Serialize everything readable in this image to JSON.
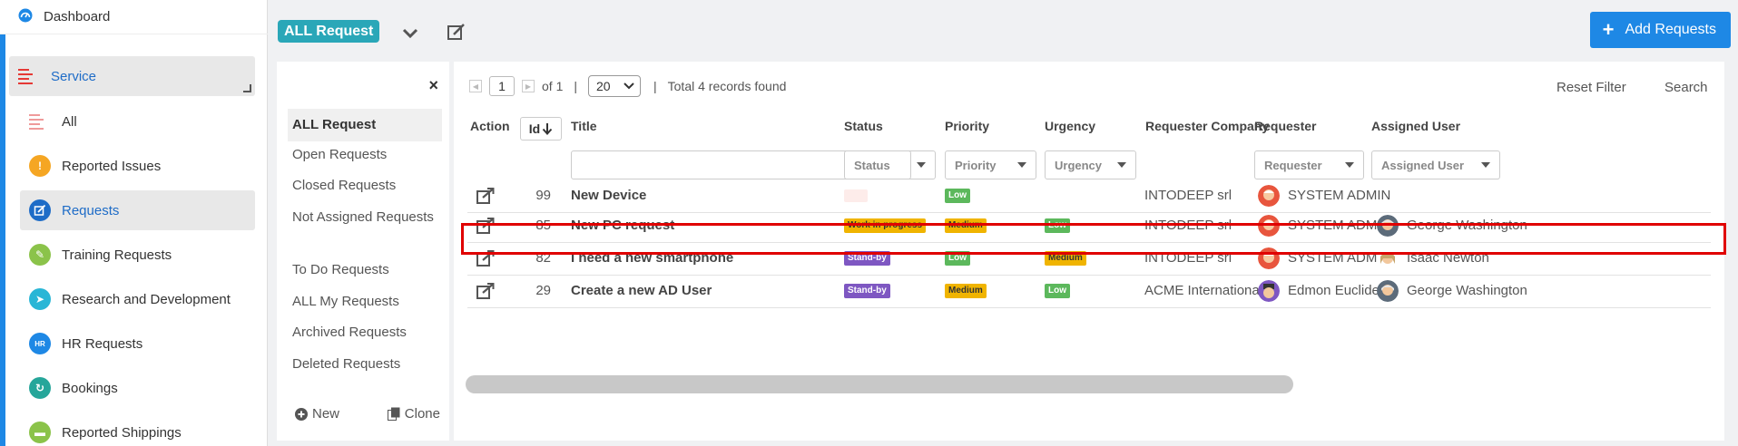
{
  "sidebar": {
    "dashboard_label": "Dashboard",
    "service_label": "Service",
    "items": [
      {
        "label": "All",
        "icon": "list-icon",
        "color": "#e53935"
      },
      {
        "label": "Reported Issues",
        "icon": "warning-icon",
        "color": "#f5a623"
      },
      {
        "label": "Requests",
        "icon": "edit-request-icon",
        "color": "#1e6cc7"
      },
      {
        "label": "Training Requests",
        "icon": "training-icon",
        "color": "#8bc34a"
      },
      {
        "label": "Research and Development",
        "icon": "research-icon",
        "color": "#29b6d6"
      },
      {
        "label": "HR Requests",
        "icon": "hr-icon",
        "color": "#1e88e5"
      },
      {
        "label": "Bookings",
        "icon": "booking-icon",
        "color": "#26a69a"
      },
      {
        "label": "Reported Shippings",
        "icon": "shipping-icon",
        "color": "#8bc34a"
      }
    ],
    "hr_icon_text": "HR"
  },
  "header": {
    "view_label": "ALL Request",
    "add_button_label": "Add Requests"
  },
  "filters": {
    "items": [
      "ALL Request",
      "Open Requests",
      "Closed Requests",
      "Not Assigned Requests",
      "To Do Requests",
      "ALL My Requests",
      "Archived Requests",
      "Deleted Requests"
    ],
    "close_label": "×",
    "new_label": "New",
    "clone_label": "Clone"
  },
  "toolbar": {
    "page": "1",
    "of_label": "of 1",
    "separator": "|",
    "page_size": "20",
    "records_text": "Total 4 records found",
    "reset_filter_label": "Reset Filter",
    "search_label": "Search"
  },
  "table": {
    "headers": {
      "action": "Action",
      "id": "Id",
      "title": "Title",
      "status": "Status",
      "priority": "Priority",
      "urgency": "Urgency",
      "company": "Requester Company",
      "requester": "Requester",
      "assigned": "Assigned User"
    },
    "filter_placeholders": {
      "status": "Status",
      "priority": "Priority",
      "urgency": "Urgency",
      "requester": "Requester",
      "assigned": "Assigned User"
    },
    "rows": [
      {
        "id": "99",
        "title": "New Device",
        "status": "",
        "status_color": "#fdecea",
        "priority": "Low",
        "priority_color": "#5cb85c",
        "urgency": "",
        "urgency_color": "",
        "company": "INTODEEP srl",
        "requester": "SYSTEM ADMIN",
        "assigned": ""
      },
      {
        "id": "85",
        "title": "New PC request",
        "status": "Work in progress",
        "status_color": "#f0b400",
        "priority": "Medium",
        "priority_color": "#f0b400",
        "urgency": "Low",
        "urgency_color": "#5cb85c",
        "company": "INTODEEP srl",
        "requester": "SYSTEM ADMIN",
        "assigned": "George Washington"
      },
      {
        "id": "82",
        "title": "I need a new smartphone",
        "status": "Stand-by",
        "status_color": "#7e57c2",
        "priority": "Low",
        "priority_color": "#5cb85c",
        "urgency": "Medium",
        "urgency_color": "#f0b400",
        "company": "INTODEEP srl",
        "requester": "SYSTEM ADMIN",
        "assigned": "Isaac Newton"
      },
      {
        "id": "29",
        "title": "Create a new AD User",
        "status": "Stand-by",
        "status_color": "#7e57c2",
        "priority": "Medium",
        "priority_color": "#f0b400",
        "urgency": "Low",
        "urgency_color": "#5cb85c",
        "company": "ACME International",
        "requester": "Edmon Euclide",
        "assigned": "George Washington"
      }
    ]
  },
  "colors": {
    "accent": "#1e88e5",
    "badge_teal": "#2aa7b8",
    "highlight": "#e00000"
  }
}
